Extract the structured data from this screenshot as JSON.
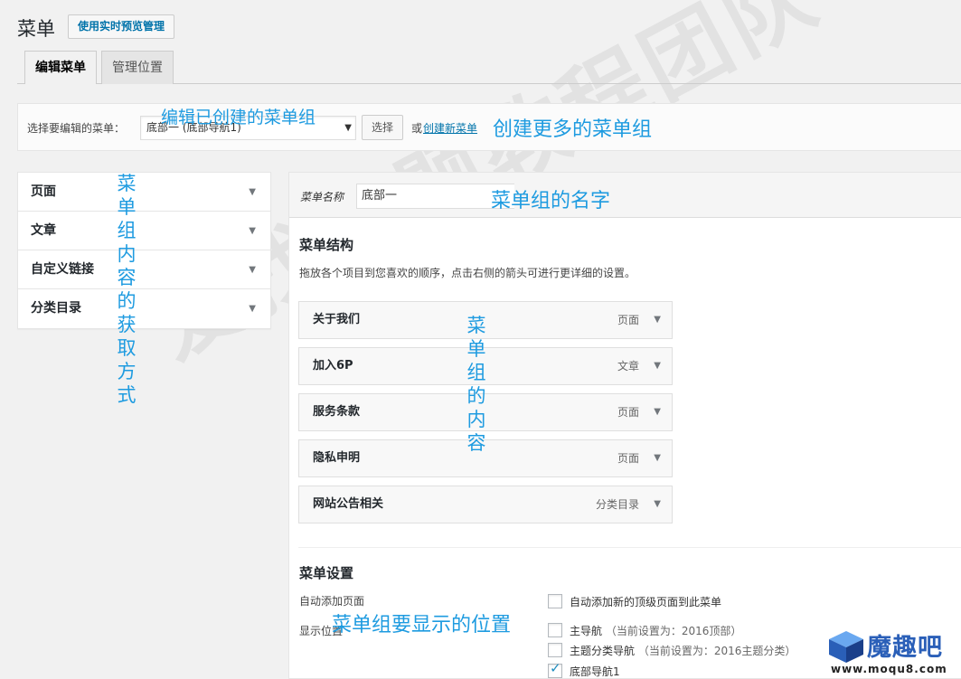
{
  "header": {
    "title": "菜单",
    "preview_button": "使用实时预览管理"
  },
  "tabs": [
    {
      "label": "编辑菜单",
      "active": true
    },
    {
      "label": "管理位置",
      "active": false
    }
  ],
  "select_bar": {
    "label": "选择要编辑的菜单：",
    "selected": "底部一 (底部导航1)",
    "select_button": "选择",
    "or_text": "或",
    "create_link": "创建新菜单"
  },
  "sidebar": {
    "items": [
      {
        "label": "页面"
      },
      {
        "label": "文章"
      },
      {
        "label": "自定义链接"
      },
      {
        "label": "分类目录"
      }
    ]
  },
  "editor": {
    "menu_name_label": "菜单名称",
    "menu_name_value": "底部一",
    "structure_title": "菜单结构",
    "structure_desc": "拖放各个项目到您喜欢的顺序，点击右侧的箭头可进行更详细的设置。",
    "items": [
      {
        "title": "关于我们",
        "type": "页面"
      },
      {
        "title": "加入6P",
        "type": "文章"
      },
      {
        "title": "服务条款",
        "type": "页面"
      },
      {
        "title": "隐私申明",
        "type": "页面"
      },
      {
        "title": "网站公告相关",
        "type": "分类目录"
      }
    ],
    "settings_title": "菜单设置",
    "auto_add_label": "自动添加页面",
    "auto_add_option": "自动添加新的顶级页面到此菜单",
    "locations_label": "显示位置",
    "locations": [
      {
        "name": "主导航",
        "note": "（当前设置为：2016顶部）",
        "checked": false
      },
      {
        "name": "主题分类导航",
        "note": "（当前设置为：2016主题分类）",
        "checked": false
      },
      {
        "name": "底部导航1",
        "note": "",
        "checked": true
      }
    ]
  },
  "annotations": {
    "edit_groups": "编辑已创建的菜单组",
    "create_more": "创建更多的菜单组",
    "group_name": "菜单组的名字",
    "content_source": "菜单组内容的获取方式",
    "group_content": "菜单组的内容",
    "display_position": "菜单组要显示的位置"
  },
  "watermark": "爱找主题教程团队",
  "logo": {
    "name": "魔趣吧",
    "url": "www.moqu8.com"
  },
  "colors": {
    "link": "#0073aa",
    "annotation": "#1e9be0",
    "background": "#f1f1f1"
  },
  "icons": {
    "dropdown_arrow": "triangle-down-icon",
    "checkbox_check": "checkmark-icon"
  }
}
